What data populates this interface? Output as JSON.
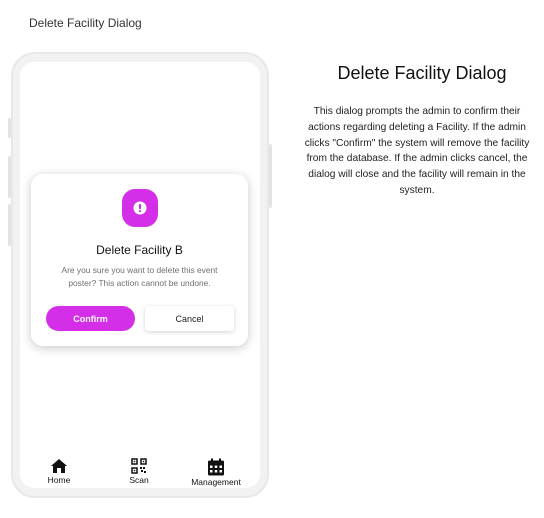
{
  "frame_label": "Delete Facility Dialog",
  "dialog": {
    "title": "Delete Facility B",
    "message": "Are you sure you want to delete this event poster? This action cannot be undone.",
    "confirm_label": "Confirm",
    "cancel_label": "Cancel",
    "icon": "alert-icon"
  },
  "bottom_nav": {
    "items": [
      {
        "label": "Home",
        "icon": "home-icon"
      },
      {
        "label": "Scan",
        "icon": "qr-scan-icon"
      },
      {
        "label": "Management",
        "icon": "calendar-icon"
      }
    ]
  },
  "description": {
    "title": "Delete Facility Dialog",
    "body": "This dialog prompts the admin to confirm their actions regarding deleting a Facility. If the admin clicks \"Confirm\" the system will remove the facility from the database. If the admin clicks cancel, the dialog will close and the facility will remain in the system."
  },
  "colors": {
    "accent": "#d42ee8",
    "phone_frame": "#f2f2f2",
    "text": "#111111"
  }
}
